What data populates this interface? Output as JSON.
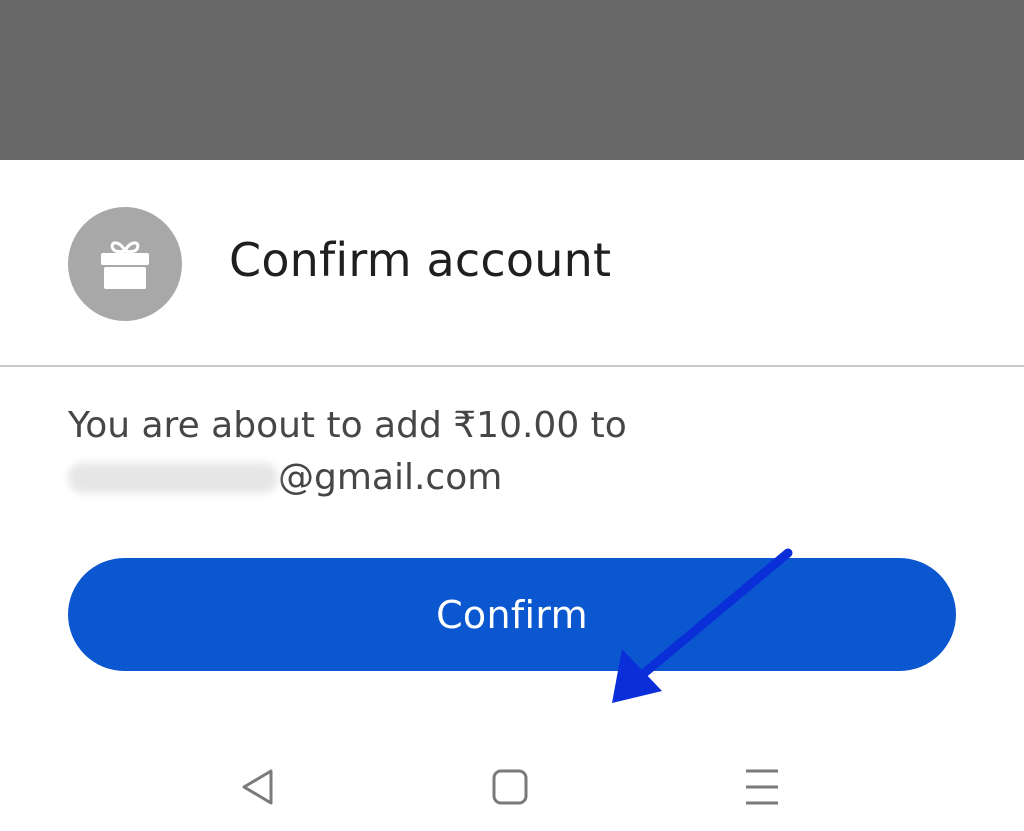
{
  "dialog": {
    "title": "Confirm account",
    "icon": "gift-icon",
    "message_line1": "You are about to add ₹10.00 to",
    "email_domain": "@gmail.com",
    "confirm_label": "Confirm"
  },
  "annotation": {
    "arrow_color": "#0a2fd8"
  },
  "navbar": {
    "back_icon": "back-triangle-icon",
    "home_icon": "home-square-icon",
    "recents_icon": "menu-lines-icon"
  },
  "colors": {
    "scrim": "#676767",
    "primary": "#0b57d0",
    "avatar_bg": "#a8a8a8",
    "title_text": "#1f1f1f",
    "body_text": "#444746"
  }
}
